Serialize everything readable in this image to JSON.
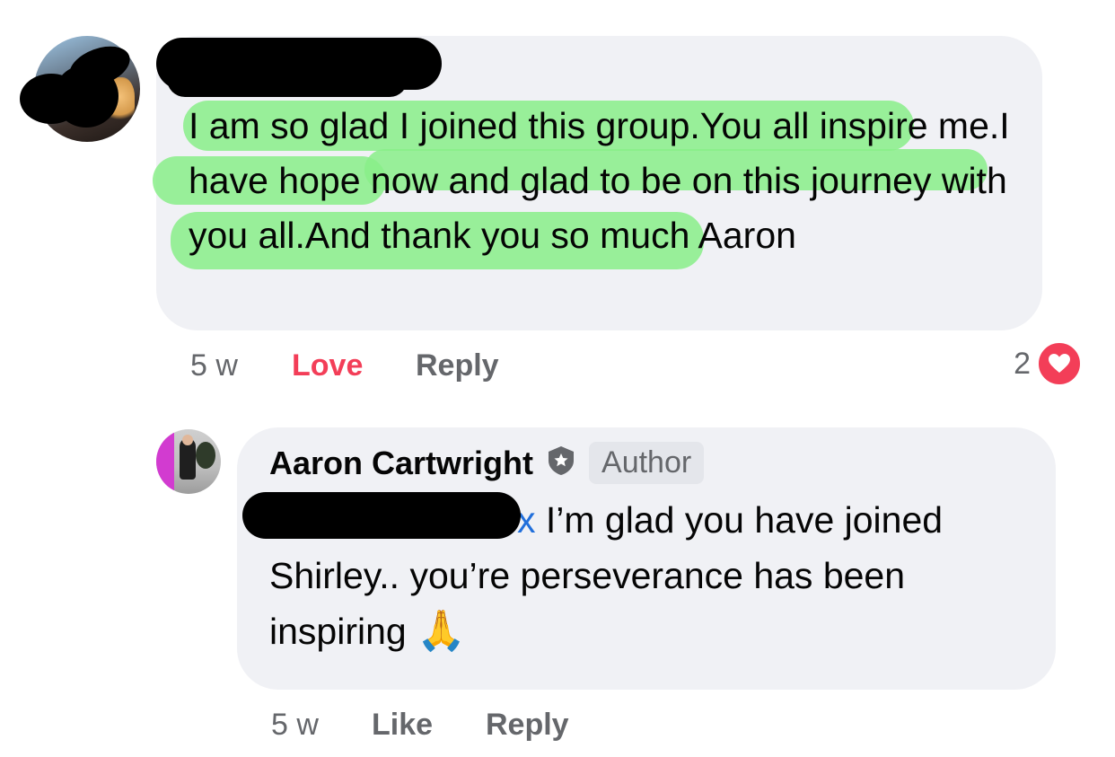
{
  "comment1": {
    "text": "I am so glad I joined this group.You all inspire me.I have hope now and glad to be on this journey with you all.And thank you so much Aaron",
    "time": "5 w",
    "love_label": "Love",
    "reply_label": "Reply",
    "reaction_count": "2",
    "reaction_icon": "heart-icon"
  },
  "comment2": {
    "author_name": "Aaron Cartwright",
    "badge_icon": "shield-icon",
    "author_badge": "Author",
    "mention_tail": "x",
    "text": " I’m glad you have joined Shirley.. you’re perseverance has been inspiring",
    "emoji": "🙏",
    "time": "5 w",
    "like_label": "Like",
    "reply_label": "Reply"
  },
  "colors": {
    "bubble": "#f0f1f5",
    "love": "#f33e58",
    "mention": "#216fdb",
    "highlight": "#88ee88",
    "meta": "#65676b"
  }
}
